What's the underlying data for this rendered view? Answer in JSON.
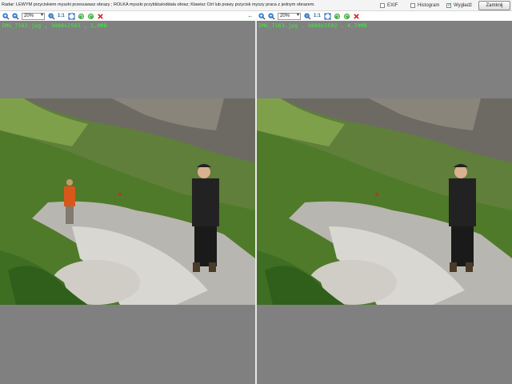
{
  "topbar": {
    "hint": "Radar: LEWYM przyciskiem myszki przesuwasz obrazy ; ROLKA myszki przybliża/oddala obraz; Klawisz Ctrl lub prawy przycisk myszy praca z jednym obrazem.",
    "options": [
      {
        "label": "EXIF",
        "checked": false
      },
      {
        "label": "Histogram",
        "checked": false
      },
      {
        "label": "Wygładź",
        "checked": true
      }
    ],
    "close_label": "Zamknij"
  },
  "toolbar": {
    "zoom_value": "20%",
    "ratio_label": "1:1"
  },
  "panes": [
    {
      "filename": "IMG_7162.jpg",
      "dimensions": "3888x2592",
      "size": "1,0MB",
      "info": "IMG_7162.jpg , 3888x2592 , 1,0MB"
    },
    {
      "filename": "IMG_7163.jpg",
      "dimensions": "3888x2592",
      "size": "4,79MB",
      "info": "IMG_7163.jpg , 3888x2592 , 4,79MB"
    }
  ],
  "colors": {
    "viewer_bg": "#808080",
    "info_text": "#3cf03c",
    "zoom_icon": "#1a5fb4",
    "refresh_icon": "#2e9d2e",
    "delete_icon": "#d42020"
  }
}
